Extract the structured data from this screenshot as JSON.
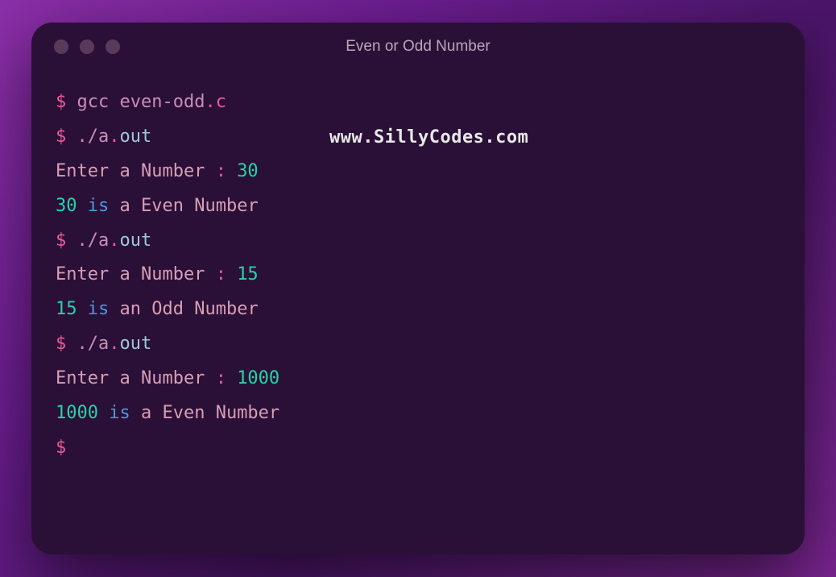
{
  "window": {
    "title": "Even or Odd Number"
  },
  "watermark": "www.SillyCodes.com",
  "term": {
    "dollar": "$",
    "gcc": "gcc even-odd",
    "dotc": ".c",
    "run_cmd_pre": "./a",
    "run_cmd_dot": ".",
    "run_cmd_out": "out",
    "enter": "Enter a Number ",
    "colon": ":",
    "input1": "30",
    "result1_num": "30",
    "is": "is",
    "result1_rest": "a Even Number",
    "input2": "15",
    "result2_num": "15",
    "result2_rest": "an Odd Number",
    "input3": "1000",
    "result3_num": "1000",
    "result3_rest": "a Even Number"
  }
}
